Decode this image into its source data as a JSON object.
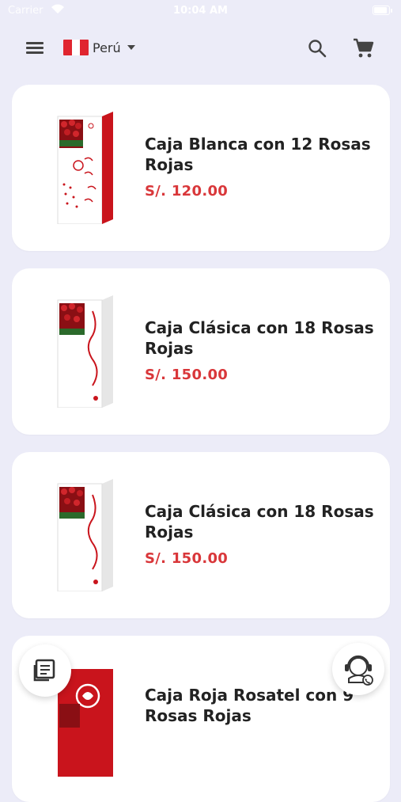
{
  "status_bar": {
    "carrier": "Carrier",
    "time": "10:04 AM"
  },
  "header": {
    "country": "Perú",
    "icons": {
      "menu": "menu-icon",
      "search": "search-icon",
      "cart": "cart-icon"
    }
  },
  "colors": {
    "background": "#ececf8",
    "price": "#d9373a",
    "flag_red": "#e0252f"
  },
  "products": [
    {
      "title": "Caja Blanca con 12 Rosas Rojas",
      "price": "S/. 120.00"
    },
    {
      "title": "Caja Clásica con 18 Rosas Rojas",
      "price": "S/. 150.00"
    },
    {
      "title": "Caja Clásica con 18 Rosas Rojas",
      "price": "S/. 150.00"
    },
    {
      "title": "Caja Roja Rosatel con 9 Rosas Rojas",
      "price": ""
    }
  ],
  "fabs": {
    "catalog_icon": "catalog-icon",
    "support_icon": "support-agent-icon"
  }
}
